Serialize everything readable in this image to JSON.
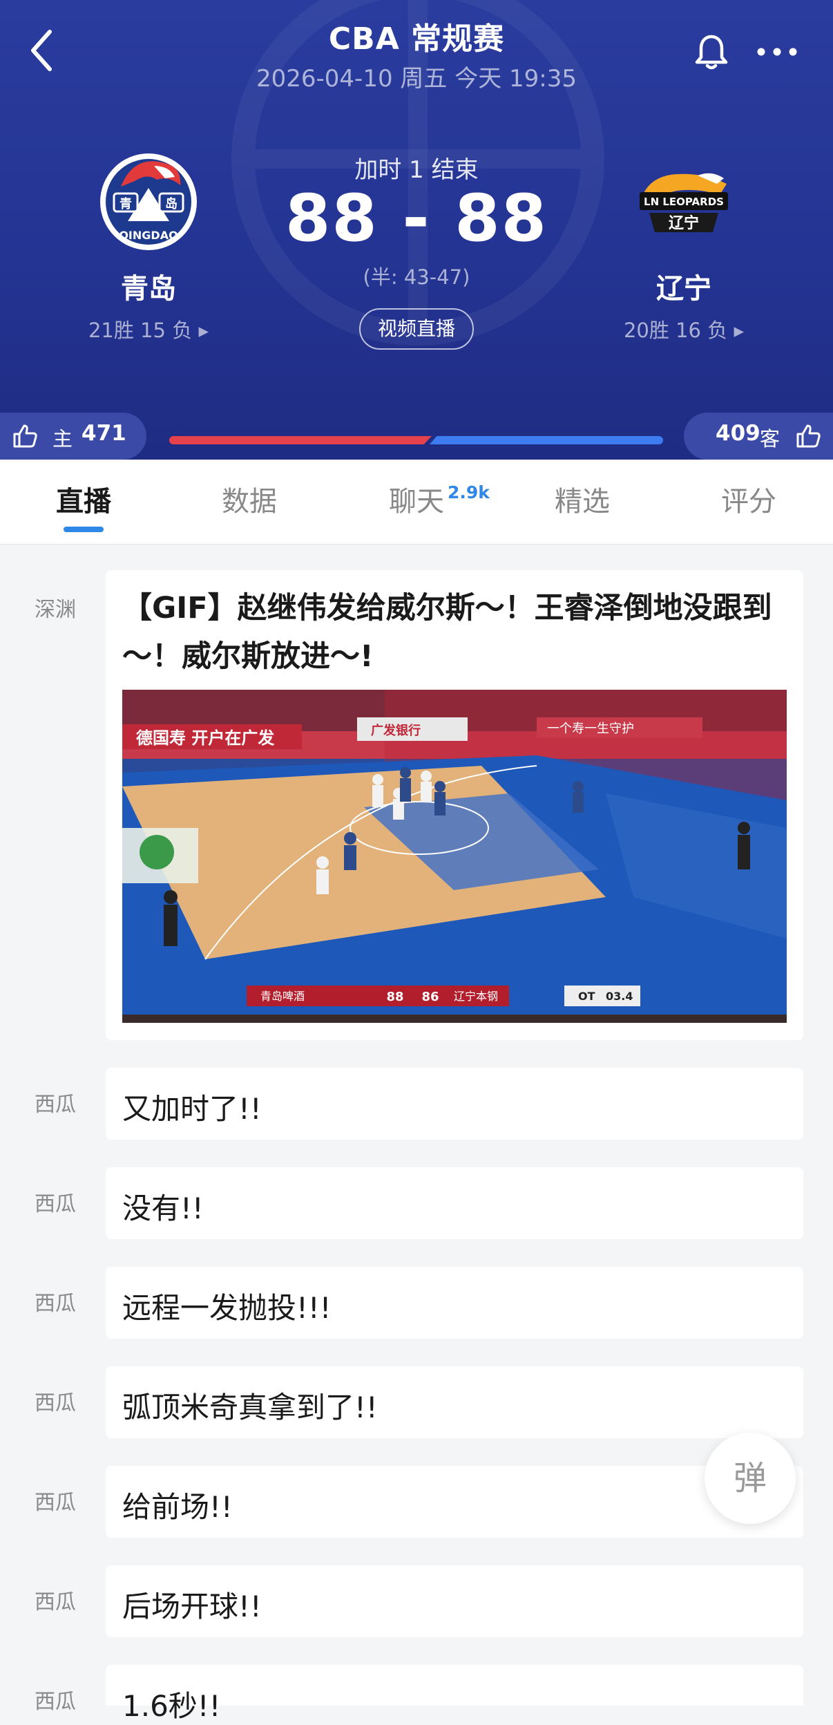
{
  "header": {
    "title": "CBA 常规赛",
    "datetime": "2026-04-10 周五 今天 19:35",
    "status": "加时 1 结束",
    "score": "88 - 88",
    "half_score": "(半: 43-47)",
    "video_button": "视频直播",
    "home": {
      "name": "青岛",
      "record": "21胜 15 负 ▸",
      "logo_text": "QINGDAO",
      "logo_chars": [
        "青",
        "岛"
      ]
    },
    "away": {
      "name": "辽宁",
      "record": "20胜 16 负 ▸",
      "logo_text": "LN LEOPARDS",
      "logo_chars": "辽宁"
    }
  },
  "likes": {
    "home_label": "主",
    "home_count": "471",
    "away_label": "客",
    "away_count": "409",
    "home_share": 0.535
  },
  "tabs": [
    {
      "label": "直播",
      "active": true
    },
    {
      "label": "数据",
      "active": false
    },
    {
      "label": "聊天",
      "active": false
    },
    {
      "label": "精选",
      "active": false
    },
    {
      "label": "评分",
      "active": false
    }
  ],
  "chat_badge": "2.9k",
  "feed": [
    {
      "author": "深渊",
      "text": "【GIF】赵继伟发给威尔斯～！王睿泽倒地没跟到～！威尔斯放进～!"
    },
    {
      "author": "西瓜",
      "text": "又加时了!!"
    },
    {
      "author": "西瓜",
      "text": "没有!!"
    },
    {
      "author": "西瓜",
      "text": "远程一发抛投!!!"
    },
    {
      "author": "西瓜",
      "text": "弧顶米奇真拿到了!!"
    },
    {
      "author": "西瓜",
      "text": "给前场!!"
    },
    {
      "author": "西瓜",
      "text": "后场开球!!"
    },
    {
      "author": "西瓜",
      "text": "1.6秒!!"
    }
  ],
  "gif_scorebug": {
    "home": "青岛啤酒",
    "home_score": "88",
    "away_score": "86",
    "away": "辽宁本钢",
    "period": "OT",
    "clock": "03.4"
  },
  "gif_banners": [
    "德国寿 开户在广发",
    "广发银行",
    "一个寿一生守护"
  ],
  "danmu_button": "弹",
  "colors": {
    "header_bg": "#243493",
    "accent_blue": "#2f87e8",
    "home_bar": "#e5424e",
    "away_bar": "#3c7cf0"
  }
}
